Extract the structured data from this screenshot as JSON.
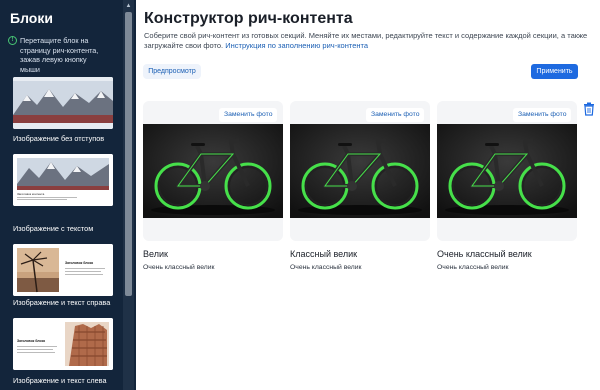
{
  "sidebar": {
    "title": "Блоки",
    "hint": "Перетащите блок на страницу рич-контента, зажав левую кнопку мыши",
    "blocks": [
      {
        "label": "Изображение без отступов"
      },
      {
        "label": "Изображение с текстом",
        "preview_caption": "Заголовок контента"
      },
      {
        "label": "Изображение и текст справа",
        "preview_caption": "Заголовок блока"
      },
      {
        "label": "Изображение и текст слева",
        "preview_caption": "Заголовок блока"
      }
    ]
  },
  "main": {
    "title": "Конструктор рич-контента",
    "description": "Соберите свой рич-контент из готовых секций. Меняйте их местами, редактируйте текст и содержание каждой секции, а также загружайте свои фото.",
    "instruction_link": "Инструкция по заполнению рич-контента",
    "preview_button": "Предпросмотр",
    "apply_button": "Применить",
    "replace_photo_label": "Заменить фото",
    "cards": [
      {
        "title": "Велик",
        "text": "Очень классный велик"
      },
      {
        "title": "Классный велик",
        "text": "Очень классный велик"
      },
      {
        "title": "Очень классный велик",
        "text": "Очень классный велик"
      }
    ]
  },
  "colors": {
    "sidebar_bg": "#13253b",
    "accent": "#1e6ae0",
    "link": "#1b5fb4",
    "bike_green": "#46e04a"
  }
}
